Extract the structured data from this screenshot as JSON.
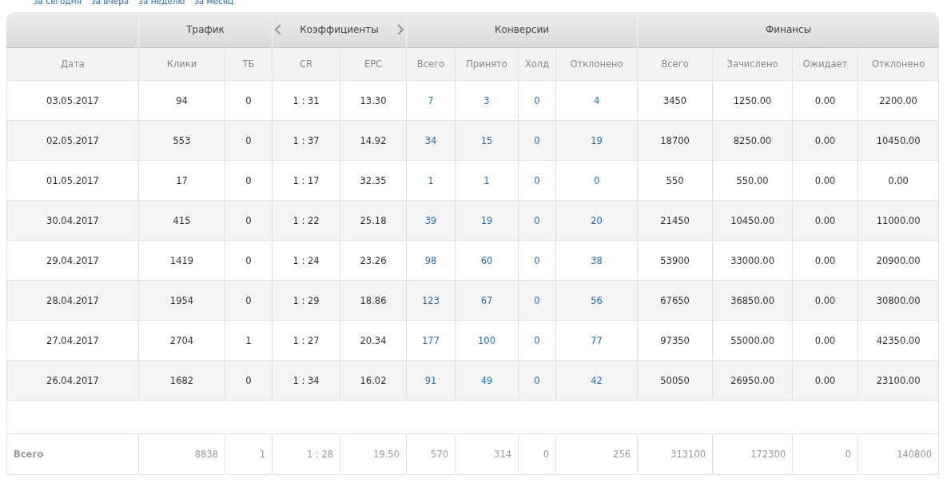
{
  "period_links": [
    "за сегодня",
    "за вчера",
    "за неделю",
    "за месяц"
  ],
  "groups": [
    {
      "columns": [
        {
          "label": "Дата",
          "kind": "text"
        }
      ]
    },
    {
      "label": "Трафик",
      "columns": [
        {
          "label": "Клики",
          "kind": "text"
        },
        {
          "label": "ТБ",
          "kind": "text"
        }
      ]
    },
    {
      "label": "Коэффициенты",
      "nav_arrows": true,
      "columns": [
        {
          "label": "CR",
          "kind": "text"
        },
        {
          "label": "EPC",
          "kind": "text"
        }
      ]
    },
    {
      "label": "Конверсии",
      "columns": [
        {
          "label": "Всего",
          "kind": "link"
        },
        {
          "label": "Принято",
          "kind": "link"
        },
        {
          "label": "Холд",
          "kind": "link"
        },
        {
          "label": "Отклонено",
          "kind": "link"
        }
      ]
    },
    {
      "label": "Финансы",
      "columns": [
        {
          "label": "Всего",
          "kind": "text"
        },
        {
          "label": "Зачислено",
          "kind": "text"
        },
        {
          "label": "Ожидает",
          "kind": "text"
        },
        {
          "label": "Отклонено",
          "kind": "text"
        }
      ]
    }
  ],
  "rows": [
    [
      "03.05.2017",
      "94",
      "0",
      "1 : 31",
      "13.30",
      "7",
      "3",
      "0",
      "4",
      "3450",
      "1250.00",
      "0.00",
      "2200.00"
    ],
    [
      "02.05.2017",
      "553",
      "0",
      "1 : 37",
      "14.92",
      "34",
      "15",
      "0",
      "19",
      "18700",
      "8250.00",
      "0.00",
      "10450.00"
    ],
    [
      "01.05.2017",
      "17",
      "0",
      "1 : 17",
      "32.35",
      "1",
      "1",
      "0",
      "0",
      "550",
      "550.00",
      "0.00",
      "0.00"
    ],
    [
      "30.04.2017",
      "415",
      "0",
      "1 : 22",
      "25.18",
      "39",
      "19",
      "0",
      "20",
      "21450",
      "10450.00",
      "0.00",
      "11000.00"
    ],
    [
      "29.04.2017",
      "1419",
      "0",
      "1 : 24",
      "23.26",
      "98",
      "60",
      "0",
      "38",
      "53900",
      "33000.00",
      "0.00",
      "20900.00"
    ],
    [
      "28.04.2017",
      "1954",
      "0",
      "1 : 29",
      "18.86",
      "123",
      "67",
      "0",
      "56",
      "67650",
      "36850.00",
      "0.00",
      "30800.00"
    ],
    [
      "27.04.2017",
      "2704",
      "1",
      "1 : 27",
      "20.34",
      "177",
      "100",
      "0",
      "77",
      "97350",
      "55000.00",
      "0.00",
      "42350.00"
    ],
    [
      "26.04.2017",
      "1682",
      "0",
      "1 : 34",
      "16.02",
      "91",
      "49",
      "0",
      "42",
      "50050",
      "26950.00",
      "0.00",
      "23100.00"
    ]
  ],
  "total": [
    "Всего",
    "8838",
    "1",
    "1 : 28",
    "19.50",
    "570",
    "314",
    "0",
    "256",
    "313100",
    "172300",
    "0",
    "140800"
  ]
}
